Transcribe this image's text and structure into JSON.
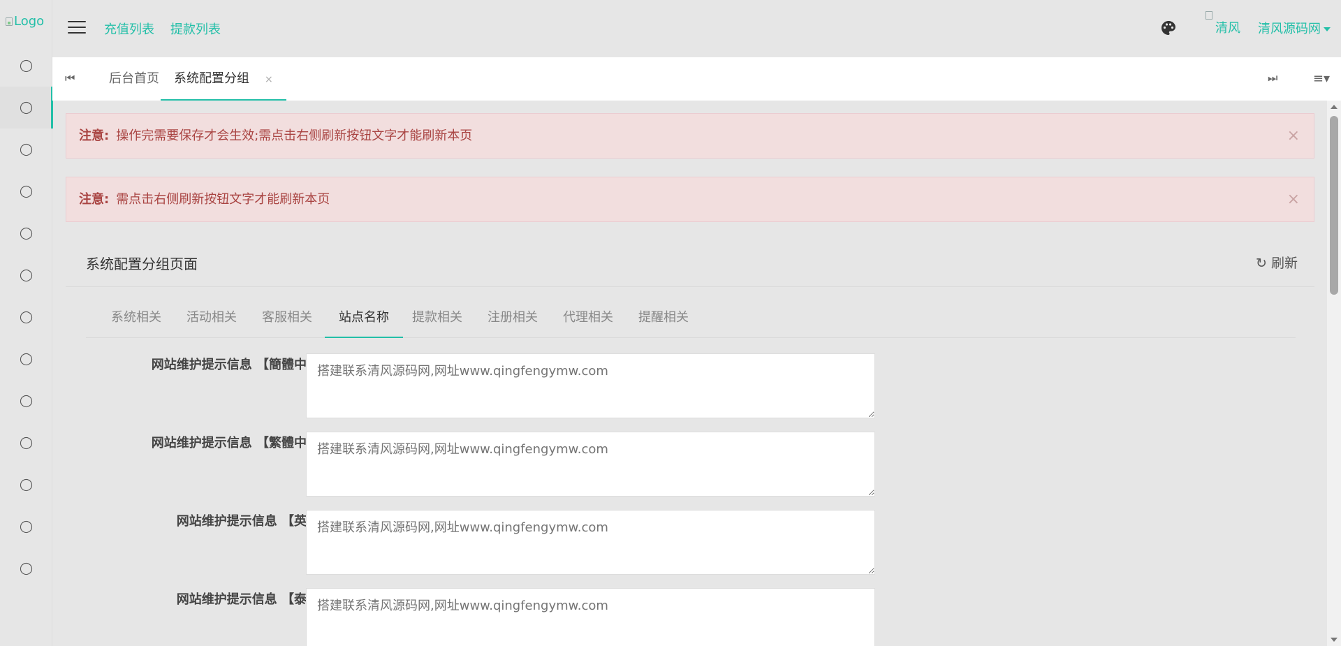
{
  "logo": {
    "alt": "Logo"
  },
  "sidebar": {
    "items": [
      {
        "icon": "circle-o-icon",
        "glyph": "◯",
        "active": false
      },
      {
        "icon": "circle-o-icon",
        "glyph": "◯",
        "active": true
      },
      {
        "icon": "circle-o-icon",
        "glyph": "◯",
        "active": false
      },
      {
        "icon": "circle-o-icon",
        "glyph": "◯",
        "active": false
      },
      {
        "icon": "circle-o-icon",
        "glyph": "◯",
        "active": false
      },
      {
        "icon": "circle-o-icon",
        "glyph": "◯",
        "active": false
      },
      {
        "icon": "circle-o-icon",
        "glyph": "◯",
        "active": false
      },
      {
        "icon": "circle-o-icon",
        "glyph": "◯",
        "active": false
      },
      {
        "icon": "circle-o-icon",
        "glyph": "◯",
        "active": false
      },
      {
        "icon": "circle-o-icon",
        "glyph": "◯",
        "active": false
      },
      {
        "icon": "circle-o-icon",
        "glyph": "◯",
        "active": false
      },
      {
        "icon": "circle-o-icon",
        "glyph": "◯",
        "active": false
      },
      {
        "icon": "circle-o-icon",
        "glyph": "◯",
        "active": false
      }
    ]
  },
  "header": {
    "links": [
      "充值列表",
      "提款列表"
    ],
    "user_image_alt": "清风",
    "user_name": "清风源码网"
  },
  "tabs": {
    "items": [
      {
        "label": "后台首页",
        "active": false
      },
      {
        "label": "系统配置分组",
        "active": true,
        "close": "×"
      }
    ]
  },
  "alerts": [
    {
      "label": "注意:",
      "text": "操作完需要保存才会生效;需点击右侧刷新按钮文字才能刷新本页",
      "close": "×"
    },
    {
      "label": "注意:",
      "text": "需点击右侧刷新按钮文字才能刷新本页",
      "close": "×"
    }
  ],
  "panel": {
    "title": "系统配置分组页面",
    "refresh_label": "刷新"
  },
  "subtabs": [
    {
      "label": "系统相关",
      "active": false
    },
    {
      "label": "活动相关",
      "active": false
    },
    {
      "label": "客服相关",
      "active": false
    },
    {
      "label": "站点名称",
      "active": true
    },
    {
      "label": "提款相关",
      "active": false
    },
    {
      "label": "注册相关",
      "active": false
    },
    {
      "label": "代理相关",
      "active": false
    },
    {
      "label": "提醒相关",
      "active": false
    }
  ],
  "form": {
    "fields": [
      {
        "label": "网站维护提示信息 【簡體中文】",
        "placeholder": "搭建联系清风源码网,网址www.qingfengymw.com"
      },
      {
        "label": "网站维护提示信息 【繁體中文】",
        "placeholder": "搭建联系清风源码网,网址www.qingfengymw.com"
      },
      {
        "label": "网站维护提示信息 【英文】",
        "placeholder": "搭建联系清风源码网,网址www.qingfengymw.com"
      },
      {
        "label": "网站维护提示信息 【泰文】",
        "placeholder": "搭建联系清风源码网,网址www.qingfengymw.com"
      }
    ]
  },
  "colors": {
    "accent": "#23bfa8",
    "alert_bg": "#f2dede",
    "alert_text": "#a94442"
  }
}
